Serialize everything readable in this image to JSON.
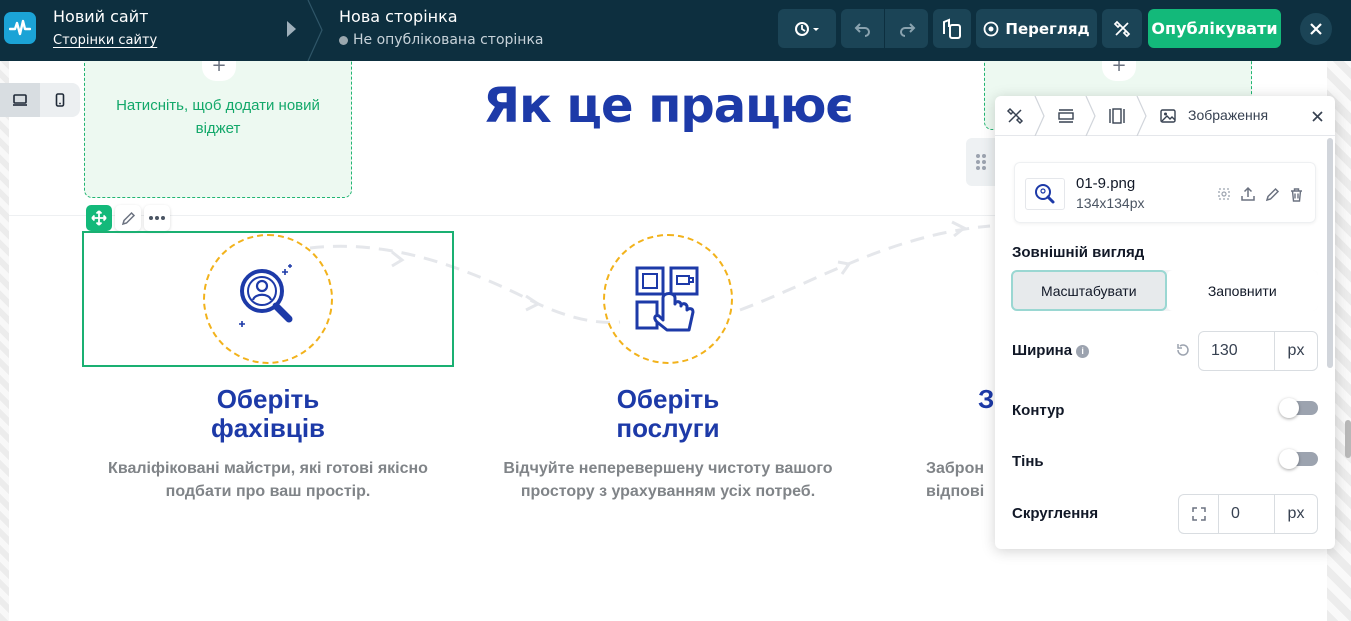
{
  "topbar": {
    "site_title": "Новий сайт",
    "site_pages_link": "Сторінки сайту",
    "page_title": "Нова сторінка",
    "page_status": "Не опублікована сторінка",
    "preview_label": "Перегляд",
    "publish_label": "Опублікувати",
    "colors": {
      "bar": "#0d2f3f",
      "publish": "#13b97a",
      "logo": "#1ba3d6"
    }
  },
  "canvas": {
    "placeholder_text": "Натисніть, щоб додати новий віджет",
    "placeholder_plus": "+",
    "headline": "Як це працює",
    "steps": [
      {
        "title_line1": "Оберіть",
        "title_line2": "фахівців",
        "desc_line1": "Кваліфіковані майстри, які готові якісно",
        "desc_line2": "подбати про ваш простір.",
        "icon": "search-person-icon"
      },
      {
        "title_line1": "Оберіть",
        "title_line2": "послуги",
        "desc_line1": "Відчуйте неперевершену чистоту вашого",
        "desc_line2": "простору з урахуванням усіх потреб.",
        "icon": "tap-screen-icon"
      },
      {
        "title_line1": "З",
        "title_line2": "",
        "desc_line1": "Заброн",
        "desc_line2": "відпові",
        "icon": ""
      }
    ],
    "colors": {
      "headline": "#1d3aa8",
      "circle_border": "#f2b21b",
      "selection": "#1ab072"
    }
  },
  "panel": {
    "tab_label": "Зображення",
    "file": {
      "name": "01-9.png",
      "size": "134x134px"
    },
    "appearance_label": "Зовнішній вигляд",
    "appearance_options": [
      "Масштабувати",
      "Заповнити"
    ],
    "width_label": "Ширина",
    "width_value": "130",
    "width_unit": "px",
    "outline_label": "Контур",
    "shadow_label": "Тінь",
    "radius_label": "Скруглення",
    "radius_value": "0",
    "radius_unit": "px"
  }
}
